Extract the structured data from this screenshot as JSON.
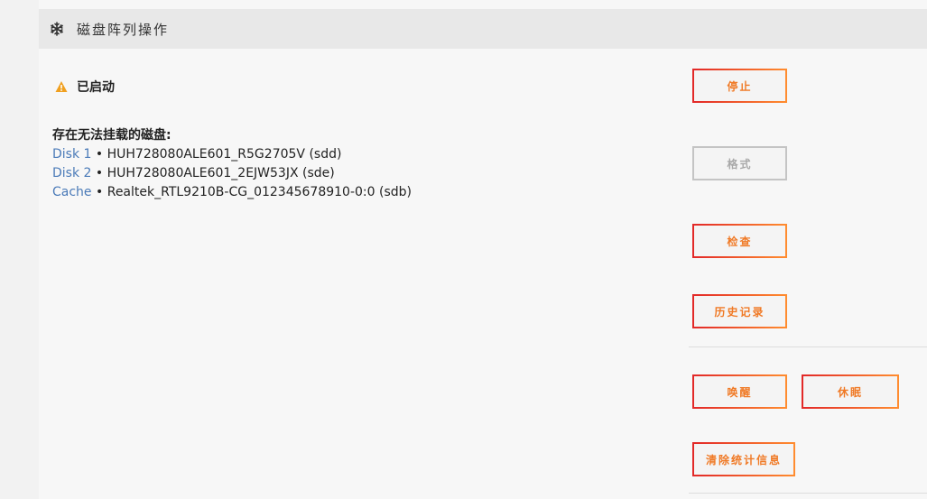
{
  "header": {
    "icon": "snowflake-icon",
    "title": "磁盘阵列操作"
  },
  "status": {
    "icon": "warning-icon",
    "icon_color": "#f0a020",
    "text": "已启动"
  },
  "unmountable": {
    "title": "存在无法挂载的磁盘:",
    "disks": [
      {
        "name": "Disk 1",
        "separator": "•",
        "device": "HUH728080ALE601_R5G2705V (sdd)"
      },
      {
        "name": "Disk 2",
        "separator": "•",
        "device": "HUH728080ALE601_2EJW53JX (sde)"
      },
      {
        "name": "Cache",
        "separator": "•",
        "device": "Realtek_RTL9210B-CG_012345678910-0:0 (sdb)"
      }
    ]
  },
  "buttons": {
    "stop": "停止",
    "format": "格式",
    "check": "检查",
    "history": "历史记录",
    "wake": "唤醒",
    "sleep": "休眠",
    "clear_stats": "清除统计信息"
  },
  "colors": {
    "accent_start": "#e22828",
    "accent_end": "#ff8c2f",
    "button_text": "#f07a26",
    "link": "#4a7ab8",
    "disabled": "#a8a8a8"
  }
}
